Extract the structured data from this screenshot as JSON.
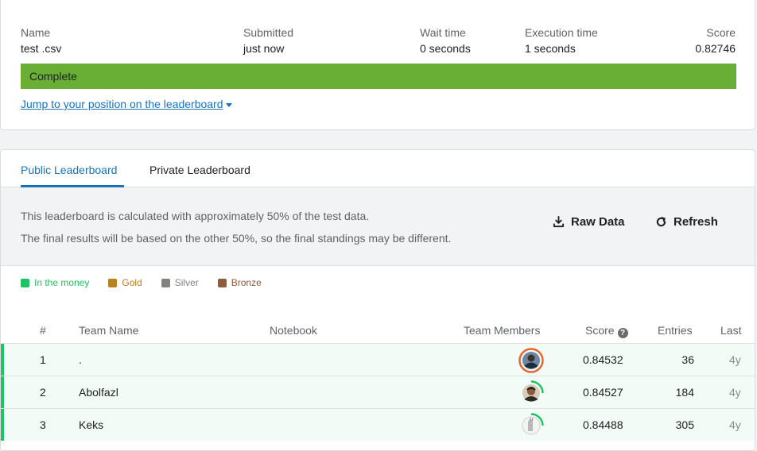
{
  "submission": {
    "headers": {
      "name": "Name",
      "submitted": "Submitted",
      "wait": "Wait time",
      "exec": "Execution time",
      "score": "Score"
    },
    "values": {
      "name": "test .csv",
      "submitted": "just now",
      "wait": "0 seconds",
      "exec": "1 seconds",
      "score": "0.82746"
    },
    "status": "Complete",
    "status_color": "#6aaf35",
    "jump_link": "Jump to your position on the leaderboard"
  },
  "leaderboard": {
    "tabs": [
      "Public Leaderboard",
      "Private Leaderboard"
    ],
    "active_tab": 0,
    "info_lines": [
      "This leaderboard is calculated with approximately 50% of the test data.",
      "The final results will be based on the other 50%, so the final standings may be different."
    ],
    "raw_data_label": "Raw Data",
    "refresh_label": "Refresh",
    "legend": [
      {
        "label": "In the money",
        "color": "#20c264"
      },
      {
        "label": "Gold",
        "color": "#b88121"
      },
      {
        "label": "Silver",
        "color": "#838280"
      },
      {
        "label": "Bronze",
        "color": "#8e5b3d"
      }
    ],
    "columns": {
      "rank": "#",
      "team": "Team Name",
      "notebook": "Notebook",
      "members": "Team Members",
      "score": "Score",
      "entries": "Entries",
      "last": "Last"
    },
    "rows": [
      {
        "rank": "1",
        "team": ".",
        "score": "0.84532",
        "entries": "36",
        "last": "4y",
        "avatar": "avatar-photo-1"
      },
      {
        "rank": "2",
        "team": "Abolfazl",
        "score": "0.84527",
        "entries": "184",
        "last": "4y",
        "avatar": "avatar-photo-2"
      },
      {
        "rank": "3",
        "team": "Keks",
        "score": "0.84488",
        "entries": "305",
        "last": "4y",
        "avatar": "avatar-photo-3"
      }
    ]
  }
}
